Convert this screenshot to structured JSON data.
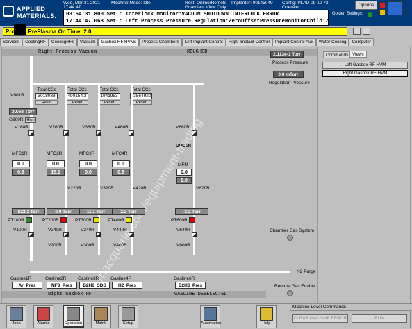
{
  "header": {
    "logo_text_1": "APPLIED",
    "logo_text_2": "MATERIALS.",
    "date": "Wed, Mar 31 2021",
    "time": "17:44:47",
    "machine_mode": "Machine Mode: Idle",
    "host": "Host: Online/Remote",
    "guardian": "Guardian: View Only",
    "implanter": "Implanter: 00145049",
    "operator": "Operator:",
    "config": "Config: PLAD 09 10 72",
    "alarm_1": "03:54:31.800 Set    : Interlock Monitor:VACUUM SHUTDOWN INTERLOCK ERROR",
    "alarm_2": "17:44:47.068 Set    : Left Process Pressure Regulation:ZeroOffsetPressureMonitorChild:ZERO OFF",
    "options": "Options",
    "golden": "Golden Settings:"
  },
  "status_bar": {
    "text": "Pro    Left PrePlasma On Time: 2.0"
  },
  "tabs": [
    "Services",
    "CoolingRF",
    "CoolingRFs",
    "Vacuum",
    "Gasbox RF HVMs",
    "Process Chambers",
    "Left Implant Control",
    "Right Implant Control",
    "Implant Control Aux",
    "Water Cooling",
    "Computer"
  ],
  "main": {
    "top_left": "Right Process Vacuum",
    "top_right": "ROUGHED",
    "process_pressure": "2.113e-1 Torr",
    "process_pressure_label": "Process Pressure",
    "regulation_pressure": "0.0 mTorr",
    "regulation_label": "Regulation Pressure",
    "bottom_left": "Right Gasbox RF",
    "bottom_right": "GASLINE DESELECTED",
    "v901": "V901R",
    "g900": "G900R",
    "g900_val": "30.68 Torr",
    "high": "High",
    "n2": "N2 Purge",
    "chamber_gas": "Chamber Gas System",
    "remote_gas": "Remote Gas Enable",
    "upc": "UPC6R",
    "mfm": "MFM",
    "mfm_v1": "0.0",
    "mfm_v2": "0.0",
    "totals": [
      {
        "label": "Total CCs",
        "value": "3018038",
        "reset": "Reset"
      },
      {
        "label": "Total CCs",
        "value": "490154.3",
        "reset": "Reset"
      },
      {
        "label": "Total CCs",
        "value": "1941953",
        "reset": "Reset"
      },
      {
        "label": "Total CCs",
        "value": "33564920",
        "reset": "Reset"
      }
    ],
    "lines": [
      {
        "v_top": "V160R",
        "mfc": "MFC1R",
        "sp": "0.0",
        "fl": "0.9",
        "v_out": "",
        "pr": "622.2 Torr",
        "pt": "PT100R",
        "v_a": "V100R",
        "v_b": "",
        "v_c": "",
        "gl": "Gasline1R",
        "gas": "Ar_Pres",
        "pt_color": "#2e8b2e"
      },
      {
        "v_top": "V260R",
        "mfc": "MFC2R",
        "sp": "0.0",
        "fl": "15.1",
        "v_out": "V220R",
        "pr": "0.0 Torr",
        "pt": "PT200R",
        "v_a": "V240R",
        "v_b": "V200R",
        "v_c": "",
        "gl": "Gasline2R",
        "gas": "NF3_Pres",
        "pt_color": "#dd0000"
      },
      {
        "v_top": "V360R",
        "mfc": "MFC3R",
        "sp": "0.0",
        "fl": "0.0",
        "v_out": "V320R",
        "pr": "11.1 Torr",
        "pt": "PT300R",
        "v_a": "V340R",
        "v_b": "V300R",
        "v_c": "",
        "gl": "Gasline3R",
        "gas": "B2H6_SDS",
        "pt_color": "#e6e600"
      },
      {
        "v_top": "V460R",
        "mfc": "MFC4R",
        "sp": "0.0",
        "fl": "0.6",
        "v_out": "V420R",
        "pr": "2.2 Torr",
        "pt": "PT400R",
        "v_a": "V440R",
        "v_b": "V400R",
        "v_c": "",
        "gl": "Gasline4R",
        "gas": "H2_Pres",
        "pt_color": "#e6e600"
      },
      {
        "v_top": "V660R",
        "mfc": "",
        "sp": "",
        "fl": "",
        "v_out": "V620R",
        "pr": "-3.3 Torr",
        "pt": "PT600R",
        "v_a": "V640R",
        "v_b": "V600R",
        "v_c": "",
        "gl": "Gasline6R",
        "gas": "B2H6_Pres",
        "pt_color": "#dd0000"
      }
    ]
  },
  "right": {
    "tab_commands": "Commands",
    "tab_views": "Views",
    "btn_left": "Left Gasbox RF HVM",
    "btn_right": "Right Gasbox RF HVM"
  },
  "bottom": {
    "buttons": [
      "Jobs",
      "Alarms",
      "Operation",
      "Maint.",
      "Setup",
      "Automation",
      "Help"
    ],
    "mc_title": "Machine Level Commands",
    "mc_clear": "CLEAR MACHINE ERROR",
    "mc_run": "RUN"
  },
  "watermark": "macquarie.com/equipment-trading"
}
